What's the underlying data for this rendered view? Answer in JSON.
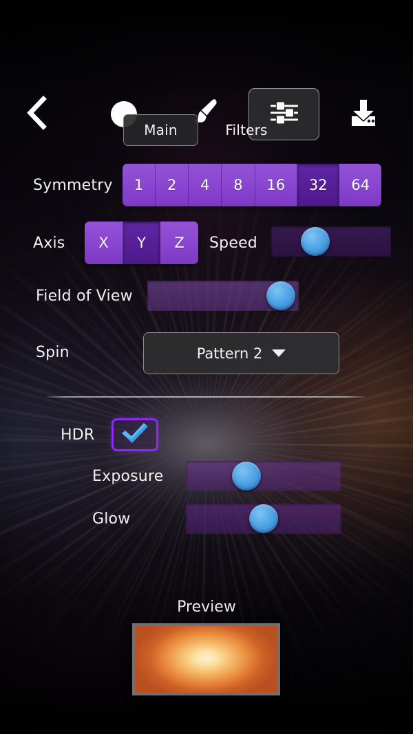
{
  "toolbar": {
    "back_icon": "chevron-left-icon",
    "circle_icon": "filled-circle-icon",
    "brush_icon": "paintbrush-icon",
    "sliders_icon": "sliders-settings-icon",
    "save_icon": "download-save-icon",
    "selected": "sliders-settings-icon"
  },
  "tabs": {
    "items": [
      {
        "label": "Main",
        "selected": true
      },
      {
        "label": "Filters",
        "selected": false
      }
    ]
  },
  "rows": {
    "symmetry": {
      "label": "Symmetry",
      "options": [
        "1",
        "2",
        "4",
        "8",
        "16",
        "32",
        "64"
      ],
      "selected_index": 5,
      "selected_value": "32"
    },
    "axis": {
      "label": "Axis",
      "options": [
        "X",
        "Y",
        "Z"
      ],
      "selected_index": 1,
      "selected_value": "Y"
    },
    "speed": {
      "label": "Speed",
      "value_percent": 37
    },
    "field_of_view": {
      "label": "Field of View",
      "value_percent": 88
    },
    "spin": {
      "label": "Spin",
      "value": "Pattern 2",
      "caret_icon": "chevron-down-icon"
    }
  },
  "hdr": {
    "label": "HDR",
    "checked": true,
    "check_icon": "checkmark-icon",
    "exposure": {
      "label": "Exposure",
      "value_percent": 39
    },
    "glow": {
      "label": "Glow",
      "value_percent": 50
    }
  },
  "preview": {
    "label": "Preview"
  },
  "colors": {
    "accent_purple": "#8a47d0",
    "accent_purple_selected": "#571f98",
    "slider_thumb_blue": "#50a5e6",
    "hdr_border_violet": "#8e29f0",
    "panel_dark": "#2e2e30",
    "text_primary": "#f0f0f0",
    "divider_gray": "#bababe",
    "preview_center": "#fdf0cf",
    "preview_edge": "#b9501f"
  }
}
